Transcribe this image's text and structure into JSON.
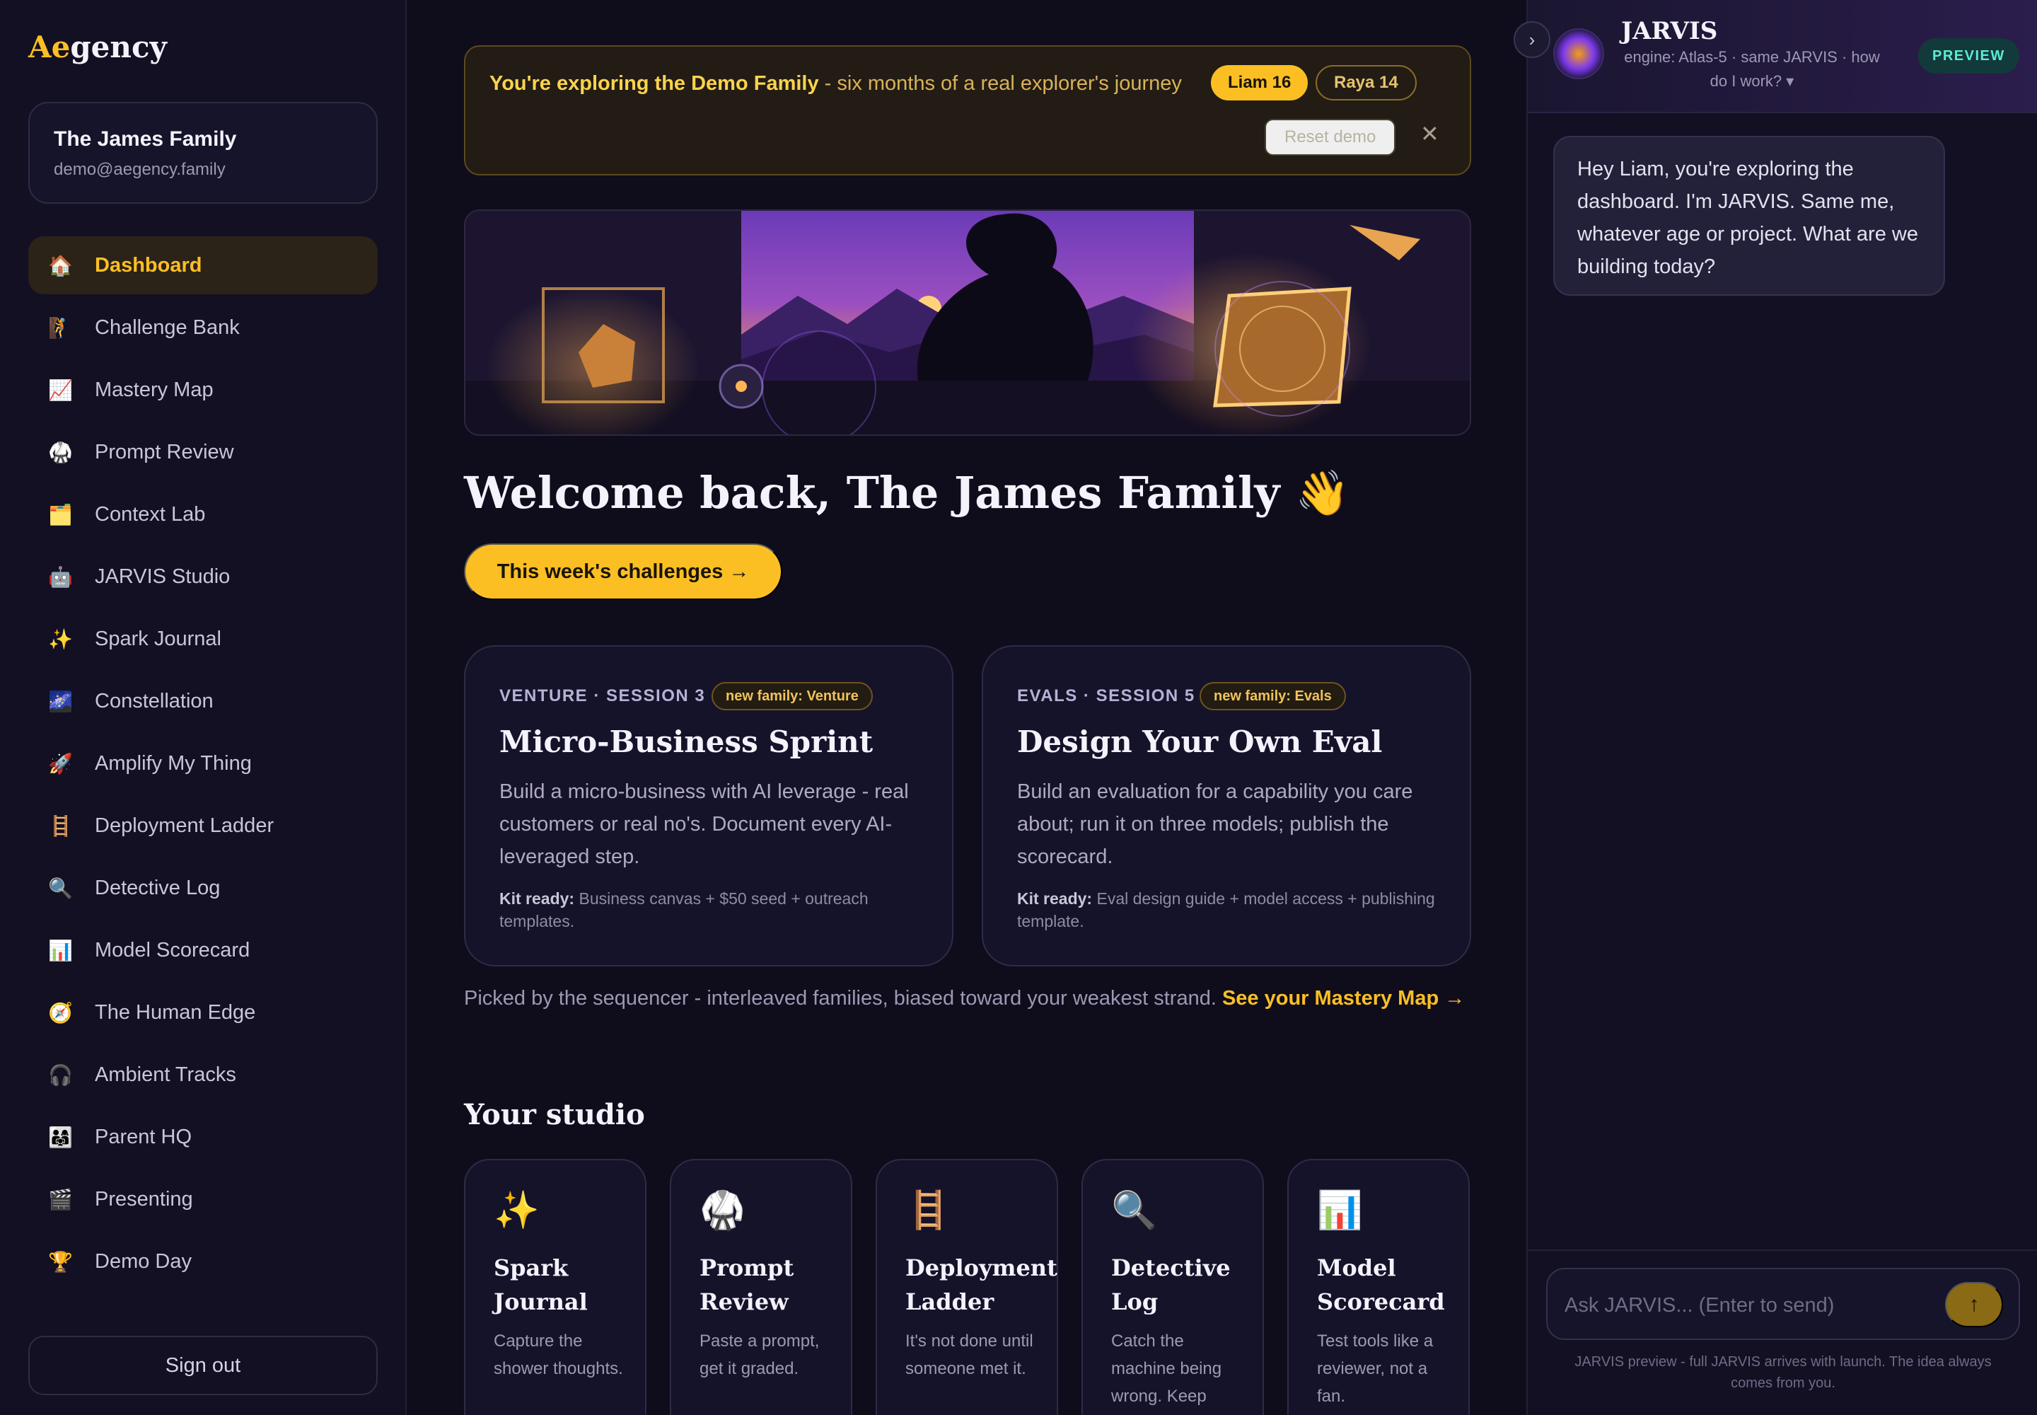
{
  "brand": {
    "logo_accent": "Ae",
    "logo_rest": "gency"
  },
  "account": {
    "family_name": "The James Family",
    "email": "demo@aegency.family"
  },
  "sidebar": {
    "items": [
      {
        "icon": "🏠",
        "label": "Dashboard",
        "active": true
      },
      {
        "icon": "🧗",
        "label": "Challenge Bank"
      },
      {
        "icon": "📈",
        "label": "Mastery Map"
      },
      {
        "icon": "🥋",
        "label": "Prompt Review"
      },
      {
        "icon": "🗂️",
        "label": "Context Lab"
      },
      {
        "icon": "🤖",
        "label": "JARVIS Studio"
      },
      {
        "icon": "✨",
        "label": "Spark Journal"
      },
      {
        "icon": "🌌",
        "label": "Constellation"
      },
      {
        "icon": "🚀",
        "label": "Amplify My Thing"
      },
      {
        "icon": "🪜",
        "label": "Deployment Ladder"
      },
      {
        "icon": "🔍",
        "label": "Detective Log"
      },
      {
        "icon": "📊",
        "label": "Model Scorecard"
      },
      {
        "icon": "🧭",
        "label": "The Human Edge"
      },
      {
        "icon": "🎧",
        "label": "Ambient Tracks"
      },
      {
        "icon": "👨‍👩‍👧",
        "label": "Parent HQ"
      },
      {
        "icon": "🎬",
        "label": "Presenting"
      },
      {
        "icon": "🏆",
        "label": "Demo Day"
      }
    ],
    "signout_label": "Sign out"
  },
  "banner": {
    "bold_text": "You're exploring the Demo Family",
    "rest_text": " - six months of a real explorer's journey",
    "chips": [
      "Liam 16",
      "Raya 14"
    ],
    "reset_label": "Reset demo",
    "close_glyph": "✕"
  },
  "welcome": {
    "title": "Welcome back, The James Family 👋",
    "cta_label": "This week's challenges →"
  },
  "challenges": [
    {
      "kicker": "VENTURE · SESSION 3",
      "tag": "new family: Venture",
      "title": "Micro-Business Sprint",
      "body": "Build a micro-business with AI leverage - real customers or real no's. Document every AI-leveraged step.",
      "kit_label": "Kit ready:",
      "kit_text": " Business canvas + $50 seed + outreach templates."
    },
    {
      "kicker": "EVALS · SESSION 5",
      "tag": "new family: Evals",
      "title": "Design Your Own Eval",
      "body": "Build an evaluation for a capability you care about; run it on three models; publish the scorecard.",
      "kit_label": "Kit ready:",
      "kit_text": " Eval design guide + model access + publishing template."
    }
  ],
  "picked": {
    "text": "Picked by the sequencer - interleaved families, biased toward your weakest strand. ",
    "link": "See your Mastery Map →"
  },
  "studio": {
    "heading": "Your studio",
    "tiles": [
      {
        "icon": "✨",
        "title": "Spark Journal",
        "desc": "Capture the shower thoughts."
      },
      {
        "icon": "🥋",
        "title": "Prompt Review",
        "desc": "Paste a prompt, get it graded."
      },
      {
        "icon": "🪜",
        "title": "Deployment Ladder",
        "desc": "It's not done until someone met it."
      },
      {
        "icon": "🔍",
        "title": "Detective Log",
        "desc": "Catch the machine being wrong. Keep"
      },
      {
        "icon": "📊",
        "title": "Model Scorecard",
        "desc": "Test tools like a reviewer, not a fan."
      }
    ]
  },
  "jarvis": {
    "collapse_glyph": "›",
    "title": "JARVIS",
    "engine": "engine: Atlas-5 · same JARVIS · how do I work? ▾",
    "badge": "PREVIEW",
    "message": "Hey Liam, you're exploring the dashboard. I'm JARVIS. Same me, whatever age or project. What are we building today?",
    "input_placeholder": "Ask JARVIS... (Enter to send)",
    "send_glyph": "↑",
    "footnote": "JARVIS preview - full JARVIS arrives with launch. The idea always comes from you."
  },
  "colors": {
    "accent": "#fbbf24",
    "background": "#0f0d1c",
    "preview_badge": "#5eead4"
  }
}
